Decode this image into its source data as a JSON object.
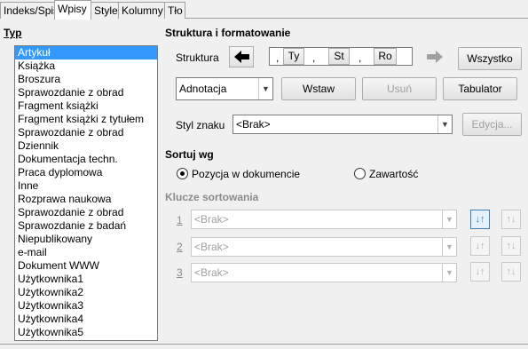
{
  "tabs": [
    {
      "label": "Indeks/Spis"
    },
    {
      "label": "Wpisy"
    },
    {
      "label": "Style"
    },
    {
      "label": "Kolumny"
    },
    {
      "label": "Tło"
    }
  ],
  "type_section": {
    "title": "Typ",
    "items": [
      "Artykuł",
      "Książka",
      "Broszura",
      "Sprawozdanie z obrad",
      "Fragment książki",
      "Fragment książki z tytułem",
      "Sprawozdanie z obrad",
      "Dziennik",
      "Dokumentacja techn.",
      "Praca dyplomowa",
      "Inne",
      "Rozprawa naukowa",
      "Sprawozdanie z obrad",
      "Sprawozdanie z badań",
      "Niepublikowany",
      "e-mail",
      "Dokument WWW",
      "Użytkownika1",
      "Użytkownika2",
      "Użytkownika3",
      "Użytkownika4",
      "Użytkownika5"
    ],
    "selected_index": 0
  },
  "structure": {
    "title": "Struktura i formatowanie",
    "label": "Struktura",
    "tokens": [
      ",",
      "Ty",
      ",",
      "St",
      ",",
      "Ro"
    ],
    "all_button": "Wszystko",
    "field_select": "Adnotacja",
    "insert_button": "Wstaw",
    "remove_button": "Usuń",
    "tab_button": "Tabulator",
    "char_style_label": "Styl znaku",
    "char_style_value": "<Brak>",
    "edit_button": "Edycja..."
  },
  "sort": {
    "title": "Sortuj wg",
    "option_position": "Pozycja w dokumencie",
    "option_content": "Zawartość",
    "selected": "position",
    "keys_title": "Klucze sortowania",
    "keys": [
      {
        "num": "1",
        "value": "<Brak>"
      },
      {
        "num": "2",
        "value": "<Brak>"
      },
      {
        "num": "3",
        "value": "<Brak>"
      }
    ]
  }
}
